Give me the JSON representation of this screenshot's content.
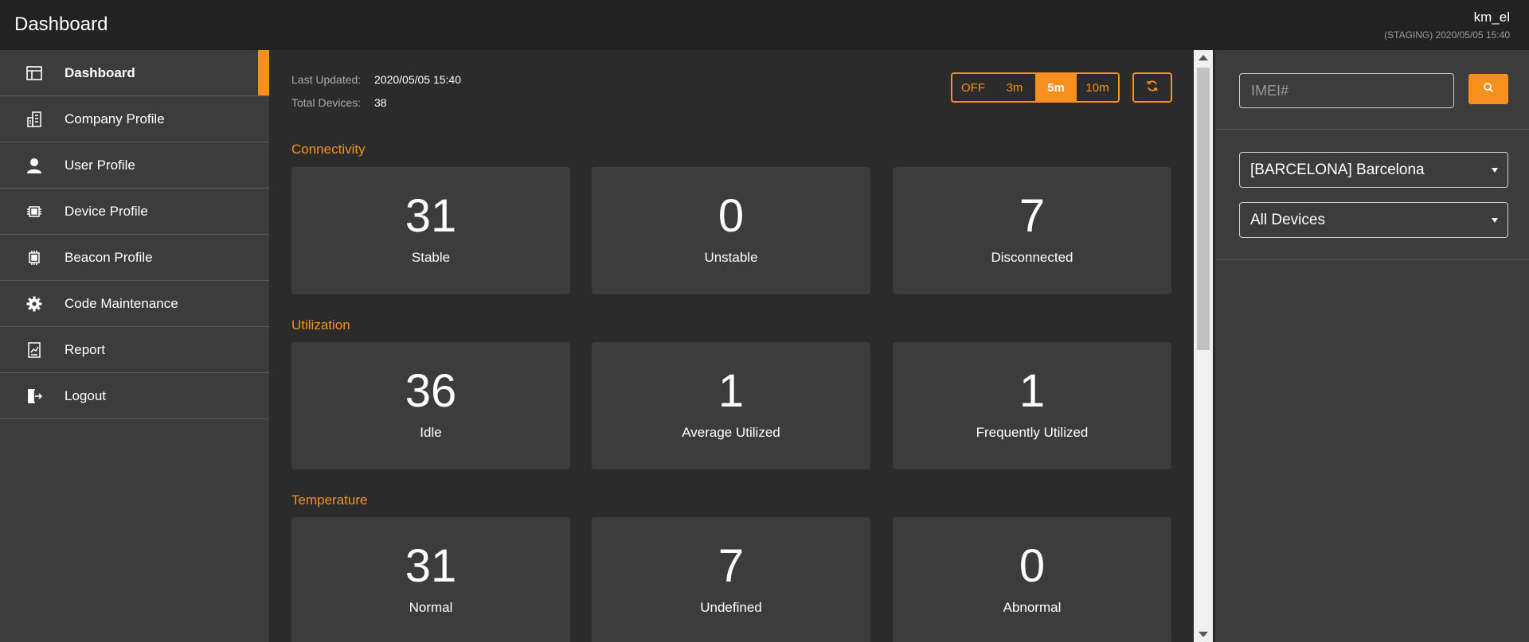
{
  "header": {
    "title": "Dashboard",
    "user": "km_el",
    "environment": "(STAGING) 2020/05/05 15:40"
  },
  "sidebar": {
    "items": [
      {
        "label": "Dashboard",
        "icon": "layout-icon",
        "active": true
      },
      {
        "label": "Company Profile",
        "icon": "building-icon"
      },
      {
        "label": "User Profile",
        "icon": "user-icon"
      },
      {
        "label": "Device Profile",
        "icon": "chip-icon"
      },
      {
        "label": "Beacon Profile",
        "icon": "chip-icon"
      },
      {
        "label": "Code Maintenance",
        "icon": "gear-icon"
      },
      {
        "label": "Report",
        "icon": "report-icon"
      },
      {
        "label": "Logout",
        "icon": "logout-icon"
      }
    ]
  },
  "main": {
    "last_updated_label": "Last Updated:",
    "last_updated_value": "2020/05/05 15:40",
    "total_devices_label": "Total Devices:",
    "total_devices_value": "38",
    "refresh_options": [
      "OFF",
      "3m",
      "5m",
      "10m"
    ],
    "refresh_selected": "5m",
    "sections": [
      {
        "title": "Connectivity",
        "cards": [
          {
            "value": "31",
            "label": "Stable"
          },
          {
            "value": "0",
            "label": "Unstable"
          },
          {
            "value": "7",
            "label": "Disconnected"
          }
        ]
      },
      {
        "title": "Utilization",
        "cards": [
          {
            "value": "36",
            "label": "Idle"
          },
          {
            "value": "1",
            "label": "Average Utilized"
          },
          {
            "value": "1",
            "label": "Frequently Utilized"
          }
        ]
      },
      {
        "title": "Temperature",
        "cards": [
          {
            "value": "31",
            "label": "Normal"
          },
          {
            "value": "7",
            "label": "Undefined"
          },
          {
            "value": "0",
            "label": "Abnormal"
          }
        ]
      }
    ]
  },
  "right_panel": {
    "imei_placeholder": "IMEI#",
    "imei_value": "",
    "location_select": "[BARCELONA] Barcelona",
    "device_filter_select": "All Devices"
  },
  "colors": {
    "accent": "#f7901e",
    "topbar": "#222222",
    "panel": "#3c3c3c",
    "background": "#2b2b2b"
  }
}
